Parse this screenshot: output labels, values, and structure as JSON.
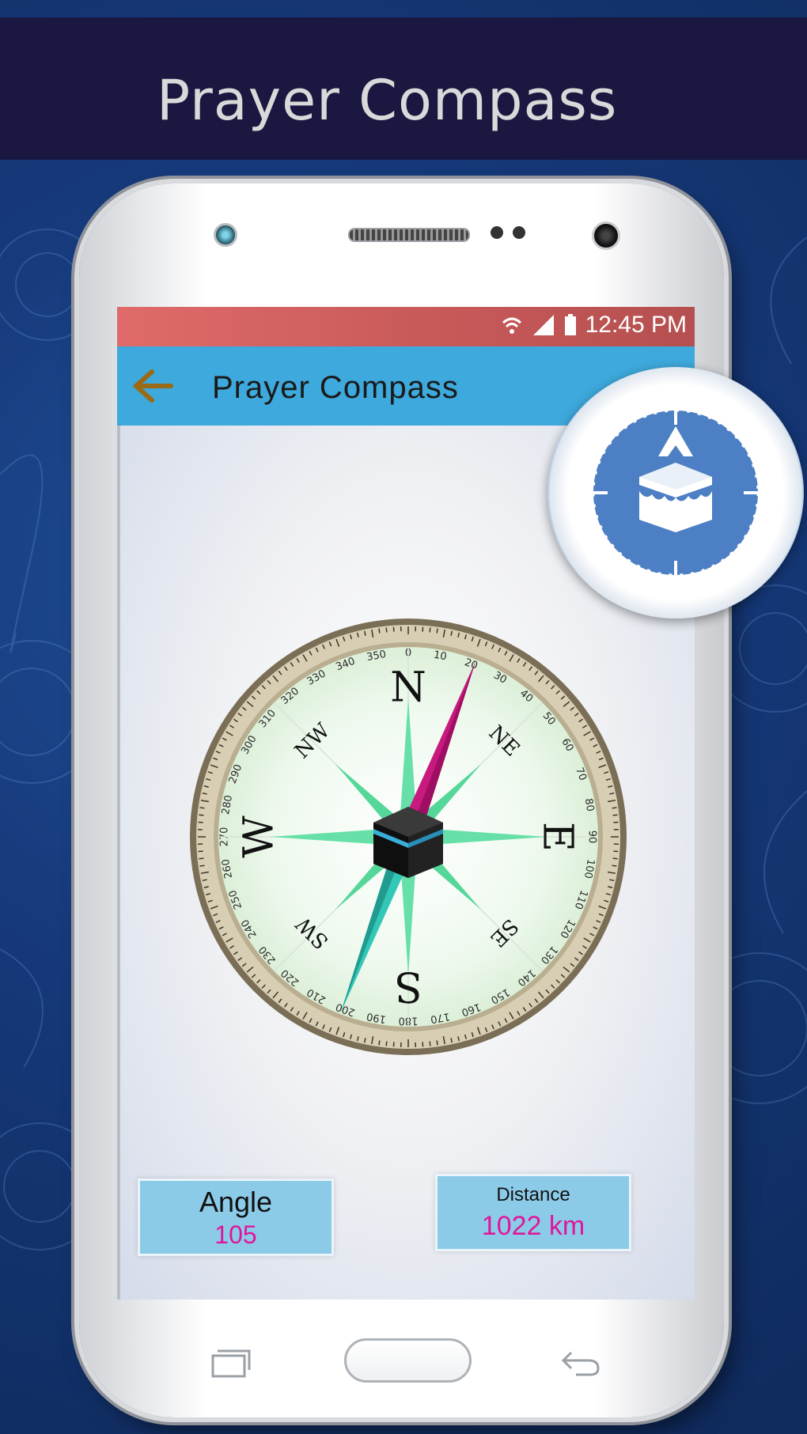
{
  "banner": {
    "title": "Prayer Compass"
  },
  "status_bar": {
    "time": "12:45 PM"
  },
  "app_bar": {
    "title": "Prayer Compass"
  },
  "compass": {
    "cardinals": [
      "N",
      "E",
      "S",
      "W"
    ],
    "intercardinals": [
      "NE",
      "SE",
      "SW",
      "NW"
    ],
    "degree_labels": [
      "0",
      "10",
      "20",
      "30",
      "40",
      "50",
      "60",
      "70",
      "80",
      "90",
      "100",
      "110",
      "120",
      "130",
      "140",
      "150",
      "160",
      "170",
      "180",
      "190",
      "200",
      "210",
      "220",
      "230",
      "240",
      "250",
      "260",
      "270",
      "280",
      "290",
      "300",
      "310",
      "320",
      "330",
      "340",
      "350"
    ],
    "needle_heading_deg": 21
  },
  "angle": {
    "label": "Angle",
    "value": "105"
  },
  "distance": {
    "label": "Distance",
    "value": "1022 km"
  },
  "colors": {
    "app_bar": "#3ea9dc",
    "value_text": "#e0169a",
    "needle_north": "#c8197f",
    "needle_south": "#33c7b7",
    "banner": "#1a1740"
  },
  "icons": [
    "back-arrow-icon",
    "wifi-icon",
    "signal-icon",
    "battery-icon",
    "kaaba-compass-icon",
    "recent-apps-icon",
    "back-icon"
  ]
}
